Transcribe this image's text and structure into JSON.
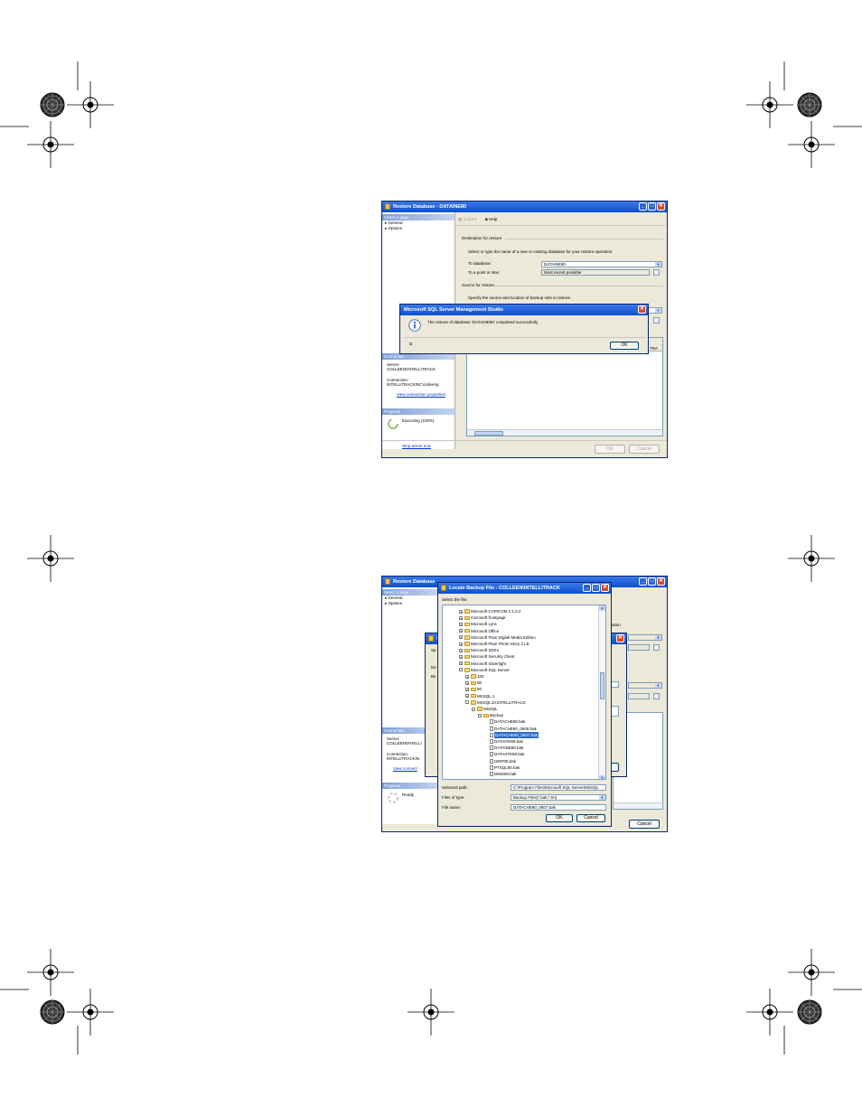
{
  "dialog1": {
    "title": "Restore Database - DATAINE80",
    "select_page_header": "Select a page",
    "pages": [
      "General",
      "Options"
    ],
    "toolbar": {
      "script": "Script",
      "help": "Help"
    },
    "destination_header": "Destination for restore",
    "destination_desc": "Select or type the name of a new or existing database for your restore operation.",
    "to_database_label": "To database:",
    "to_database_value": "DATAINE80",
    "point_in_time_label": "To a point in time:",
    "point_in_time_value": "Most recent possible",
    "source_header": "Source for restore",
    "source_desc": "Specify the source and location of backup sets to restore.",
    "grid_fragment": "TRA",
    "connection_header": "Connection",
    "server_label": "Server:",
    "server_value": "COLLEEN\\INTELLITRACK",
    "connection_label": "Connection:",
    "connection_value": "INTELLITRACK\\NC\\colleeng",
    "view_props": "View connection properties",
    "progress_header": "Progress",
    "progress_status": "Executing (100%)",
    "stop_link": "Stop action now",
    "ok": "OK",
    "cancel": "Cancel"
  },
  "messagebox": {
    "title": "Microsoft SQL Server Management Studio",
    "message": "The restore of database 'DATAINE80' completed successfully.",
    "ok": "OK"
  },
  "dialog2": {
    "bg_title": "Restore Database",
    "select_page_header": "Select a page",
    "pages": [
      "General",
      "Options"
    ],
    "connection_header": "Connection",
    "server_label": "Server:",
    "server_value": "COLLEEN\\INTELLI",
    "connection_label": "Connection:",
    "connection_value": "INTELLITRACK\\N",
    "view_props": "View connect",
    "progress_header": "Progress",
    "progress_status": "Ready",
    "bg_cancel": "Cancel",
    "bg_fragments": {
      "tion": "ation",
      "sp": "Sp",
      "de": "De",
      "be": "Be",
      "s": "S"
    }
  },
  "locate": {
    "title": "Locate Backup File - COLLEEN\\INTELLITRACK",
    "select_file_label": "Select the file:",
    "tree": [
      {
        "label": "Microsoft CAPICOM 2.1.0.2",
        "level": 0,
        "type": "folder",
        "exp": "+"
      },
      {
        "label": "microsoft frontpage",
        "level": 0,
        "type": "folder",
        "exp": "+"
      },
      {
        "label": "Microsoft Lync",
        "level": 0,
        "type": "folder",
        "exp": "+"
      },
      {
        "label": "Microsoft Office",
        "level": 0,
        "type": "folder",
        "exp": "+"
      },
      {
        "label": "Microsoft Plus! Digital Media Edition",
        "level": 0,
        "type": "folder",
        "exp": "+"
      },
      {
        "label": "Microsoft Plus! Photo Story 2 LE",
        "level": 0,
        "type": "folder",
        "exp": "+"
      },
      {
        "label": "Microsoft SDKs",
        "level": 0,
        "type": "folder",
        "exp": "+"
      },
      {
        "label": "Microsoft Security Client",
        "level": 0,
        "type": "folder",
        "exp": "+"
      },
      {
        "label": "Microsoft Silverlight",
        "level": 0,
        "type": "folder",
        "exp": "+"
      },
      {
        "label": "Microsoft SQL Server",
        "level": 0,
        "type": "folder",
        "exp": "-"
      },
      {
        "label": "100",
        "level": 1,
        "type": "folder",
        "exp": "+"
      },
      {
        "label": "80",
        "level": 1,
        "type": "folder",
        "exp": "+"
      },
      {
        "label": "90",
        "level": 1,
        "type": "folder",
        "exp": "+"
      },
      {
        "label": "MSSQL.1",
        "level": 1,
        "type": "folder",
        "exp": "+"
      },
      {
        "label": "MSSQL10.INTELLITRACK",
        "level": 1,
        "type": "folder",
        "exp": "-"
      },
      {
        "label": "MSSQL",
        "level": 2,
        "type": "folder",
        "exp": "-"
      },
      {
        "label": "Backup",
        "level": 3,
        "type": "folder",
        "exp": "-"
      },
      {
        "label": "DATACHE80.bak",
        "level": 4,
        "type": "file",
        "exp": ""
      },
      {
        "label": "DATACHE80_0608.bak",
        "level": 4,
        "type": "file",
        "exp": ""
      },
      {
        "label": "DATACHE80_0607.bak",
        "level": 4,
        "type": "file",
        "exp": "",
        "selected": true
      },
      {
        "label": "DATAFIE80.bak",
        "level": 4,
        "type": "file",
        "exp": ""
      },
      {
        "label": "DATAINE80.bak",
        "level": 4,
        "type": "file",
        "exp": ""
      },
      {
        "label": "DATASTE80.bak",
        "level": 4,
        "type": "file",
        "exp": ""
      },
      {
        "label": "ISRP08.bak",
        "level": 4,
        "type": "file",
        "exp": ""
      },
      {
        "label": "PTSQL80.bak",
        "level": 4,
        "type": "file",
        "exp": ""
      },
      {
        "label": "WMS80.bak",
        "level": 4,
        "type": "file",
        "exp": ""
      },
      {
        "label": "Binn",
        "level": 3,
        "type": "folder",
        "exp": "+"
      }
    ],
    "selected_path_label": "Selected path:",
    "selected_path_value": "C:\\Program Files\\Microsoft SQL Server\\MSSQL",
    "files_of_type_label": "Files of type:",
    "files_of_type_value": "Backup Files(*.bak;*.tm)",
    "file_name_label": "File name:",
    "file_name_value": "DATACHE80_0607.bak",
    "ok": "OK",
    "cancel": "Cancel"
  },
  "icons": [
    "registration-crosshair-icon",
    "registration-star-icon",
    "info-icon",
    "folder-icon",
    "file-icon",
    "help-icon",
    "script-icon",
    "spinner-icon"
  ]
}
